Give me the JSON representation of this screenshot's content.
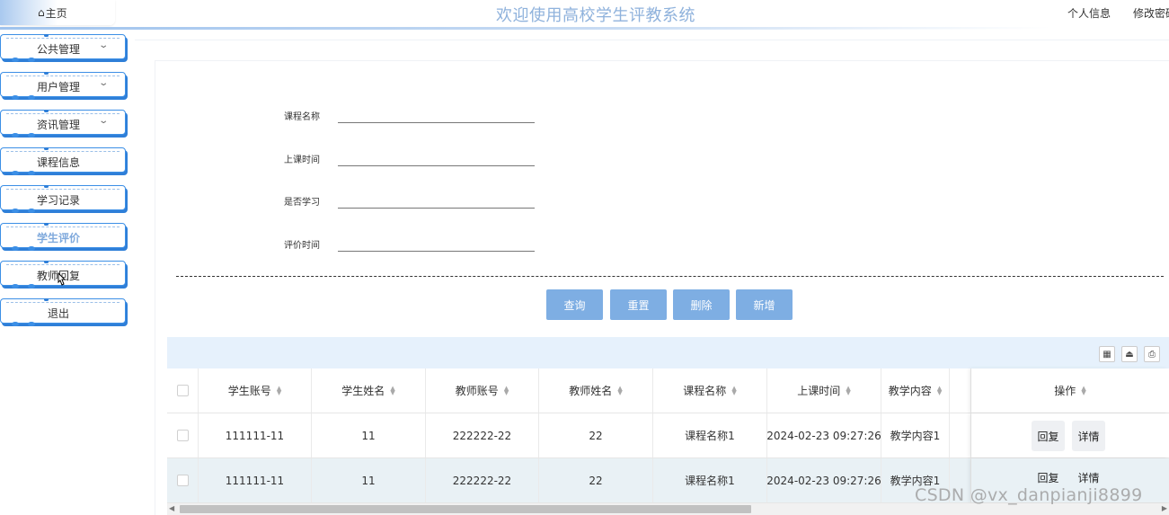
{
  "header": {
    "home": "主页",
    "title": "欢迎使用高校学生评教系统",
    "profile": "个人信息",
    "change_password": "修改密码"
  },
  "sidebar": {
    "items": [
      {
        "label": "公共管理",
        "has_children": true
      },
      {
        "label": "用户管理",
        "has_children": true
      },
      {
        "label": "资讯管理",
        "has_children": true
      },
      {
        "label": "课程信息",
        "has_children": false
      },
      {
        "label": "学习记录",
        "has_children": false
      },
      {
        "label": "学生评价",
        "has_children": false,
        "active": true
      },
      {
        "label": "教师回复",
        "has_children": false
      },
      {
        "label": "退出",
        "has_children": false
      }
    ]
  },
  "search": {
    "course_name_label": "课程名称",
    "class_time_label": "上课时间",
    "is_study_label": "是否学习",
    "eval_time_label": "评价时间"
  },
  "actions": {
    "query": "查询",
    "reset": "重置",
    "delete": "删除",
    "add": "新增"
  },
  "table": {
    "columns": [
      "学生账号",
      "学生姓名",
      "教师账号",
      "教师姓名",
      "课程名称",
      "上课时间",
      "教学内容",
      "操作"
    ],
    "rows": [
      {
        "student_account": "111111-11",
        "student_name": "11",
        "teacher_account": "222222-22",
        "teacher_name": "22",
        "course_name": "课程名称1",
        "class_time": "2024-02-23 09:27:26",
        "content": "教学内容1"
      },
      {
        "student_account": "111111-11",
        "student_name": "11",
        "teacher_account": "222222-22",
        "teacher_name": "22",
        "course_name": "课程名称1",
        "class_time": "2024-02-23 09:27:26",
        "content": "教学内容1"
      }
    ],
    "reply_label": "回复",
    "detail_label": "详情"
  },
  "watermark": "CSDN @vx_danpianji8899",
  "colors": {
    "accent": "#7eaee3",
    "menu_border": "#3c8fe6",
    "title": "#8fb2dc"
  }
}
